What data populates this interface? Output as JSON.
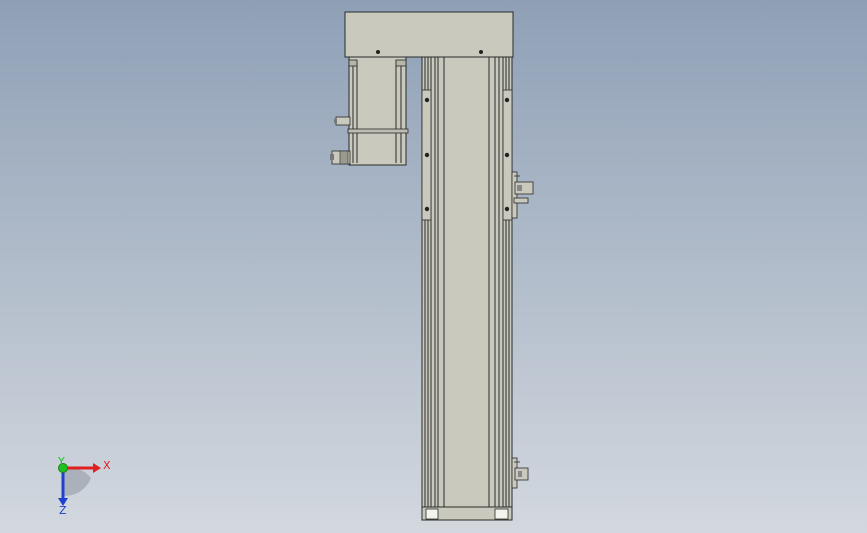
{
  "viewport": {
    "background_top": "#8fa0b6",
    "background_bottom": "#d3d8df"
  },
  "model": {
    "fill_color": "#c8c8bc",
    "edge_color": "#2a2a2a"
  },
  "triad": {
    "x_label": "X",
    "y_label": "Y",
    "z_label": "Z",
    "x_color": "#e02020",
    "y_color": "#20c020",
    "z_color": "#2040d0"
  }
}
